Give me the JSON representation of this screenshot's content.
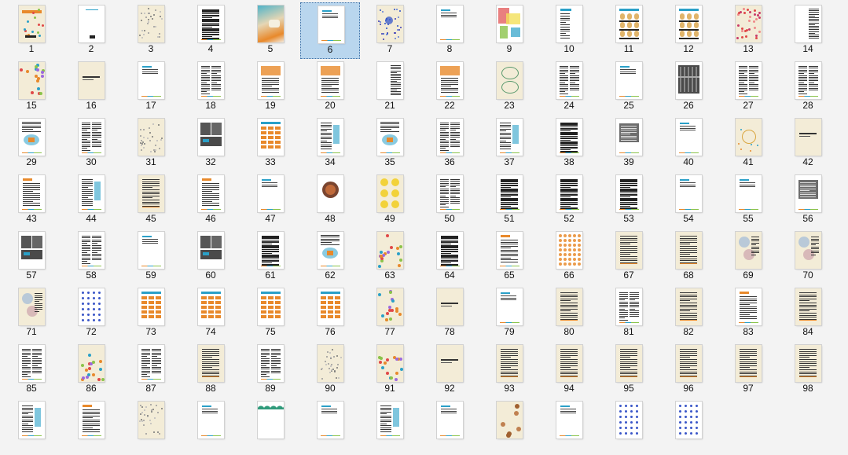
{
  "view": "thumbnail-grid",
  "selected_page": "6",
  "pages": [
    {
      "label": "1",
      "style": "cover-colorful"
    },
    {
      "label": "2",
      "style": "blank-small-logo"
    },
    {
      "label": "3",
      "style": "paper-sketch"
    },
    {
      "label": "4",
      "style": "text-dense"
    },
    {
      "label": "5",
      "style": "cover-watercolor"
    },
    {
      "label": "6",
      "style": "text-sparse"
    },
    {
      "label": "7",
      "style": "network-blue"
    },
    {
      "label": "8",
      "style": "text-sparse"
    },
    {
      "label": "9",
      "style": "color-blocks"
    },
    {
      "label": "10",
      "style": "text-list"
    },
    {
      "label": "11",
      "style": "figures"
    },
    {
      "label": "12",
      "style": "figures"
    },
    {
      "label": "13",
      "style": "paper-red-dots"
    },
    {
      "label": "14",
      "style": "text-column"
    },
    {
      "label": "15",
      "style": "paper-colorful-diagram"
    },
    {
      "label": "16",
      "style": "paper-title"
    },
    {
      "label": "17",
      "style": "text-sparse"
    },
    {
      "label": "18",
      "style": "text-two-col"
    },
    {
      "label": "19",
      "style": "text-orange-box"
    },
    {
      "label": "20",
      "style": "text-orange-box"
    },
    {
      "label": "21",
      "style": "text-column"
    },
    {
      "label": "22",
      "style": "text-orange-box"
    },
    {
      "label": "23",
      "style": "paper-green-sketch"
    },
    {
      "label": "24",
      "style": "text-two-col"
    },
    {
      "label": "25",
      "style": "text-sparse"
    },
    {
      "label": "26",
      "style": "dark-photo"
    },
    {
      "label": "27",
      "style": "text-two-col"
    },
    {
      "label": "28",
      "style": "text-two-col"
    },
    {
      "label": "29",
      "style": "text-with-diagram"
    },
    {
      "label": "30",
      "style": "text-two-col"
    },
    {
      "label": "31",
      "style": "paper-sketch"
    },
    {
      "label": "32",
      "style": "dark-panels"
    },
    {
      "label": "33",
      "style": "orange-table"
    },
    {
      "label": "34",
      "style": "text-blue-accent"
    },
    {
      "label": "35",
      "style": "text-with-diagram"
    },
    {
      "label": "36",
      "style": "text-two-col"
    },
    {
      "label": "37",
      "style": "text-blue-accent"
    },
    {
      "label": "38",
      "style": "text-dense"
    },
    {
      "label": "39",
      "style": "text-gray-box"
    },
    {
      "label": "40",
      "style": "text-sparse"
    },
    {
      "label": "41",
      "style": "paper-sketch-yellow"
    },
    {
      "label": "42",
      "style": "paper-title"
    },
    {
      "label": "43",
      "style": "text-orange-accent"
    },
    {
      "label": "44",
      "style": "text-blue-accent"
    },
    {
      "label": "45",
      "style": "paper-text"
    },
    {
      "label": "46",
      "style": "text-orange-accent"
    },
    {
      "label": "47",
      "style": "text-sparse"
    },
    {
      "label": "48",
      "style": "dark-circle"
    },
    {
      "label": "49",
      "style": "yellow-circles"
    },
    {
      "label": "50",
      "style": "text-two-col"
    },
    {
      "label": "51",
      "style": "text-dense"
    },
    {
      "label": "52",
      "style": "text-dense"
    },
    {
      "label": "53",
      "style": "text-dense"
    },
    {
      "label": "54",
      "style": "text-sparse"
    },
    {
      "label": "55",
      "style": "text-sparse"
    },
    {
      "label": "56",
      "style": "text-gray-box"
    },
    {
      "label": "57",
      "style": "dark-panels"
    },
    {
      "label": "58",
      "style": "text-two-col"
    },
    {
      "label": "59",
      "style": "text-sparse"
    },
    {
      "label": "60",
      "style": "dark-panels"
    },
    {
      "label": "61",
      "style": "text-dense"
    },
    {
      "label": "62",
      "style": "text-with-diagram"
    },
    {
      "label": "63",
      "style": "paper-colorful-diagram"
    },
    {
      "label": "64",
      "style": "text-dense"
    },
    {
      "label": "65",
      "style": "text-orange-accent"
    },
    {
      "label": "66",
      "style": "orange-dots"
    },
    {
      "label": "67",
      "style": "paper-text"
    },
    {
      "label": "68",
      "style": "paper-text"
    },
    {
      "label": "69",
      "style": "paper-circles"
    },
    {
      "label": "70",
      "style": "paper-circles"
    },
    {
      "label": "71",
      "style": "paper-circles"
    },
    {
      "label": "72",
      "style": "blue-dots"
    },
    {
      "label": "73",
      "style": "orange-table"
    },
    {
      "label": "74",
      "style": "orange-table"
    },
    {
      "label": "75",
      "style": "orange-table"
    },
    {
      "label": "76",
      "style": "orange-table"
    },
    {
      "label": "77",
      "style": "paper-colorful-diagram"
    },
    {
      "label": "78",
      "style": "paper-title"
    },
    {
      "label": "79",
      "style": "text-sparse"
    },
    {
      "label": "80",
      "style": "paper-text"
    },
    {
      "label": "81",
      "style": "text-two-col"
    },
    {
      "label": "82",
      "style": "paper-text"
    },
    {
      "label": "83",
      "style": "text-orange-accent"
    },
    {
      "label": "84",
      "style": "paper-text"
    },
    {
      "label": "85",
      "style": "text-two-col"
    },
    {
      "label": "86",
      "style": "paper-colorful-diagram"
    },
    {
      "label": "87",
      "style": "text-two-col"
    },
    {
      "label": "88",
      "style": "paper-text"
    },
    {
      "label": "89",
      "style": "text-two-col"
    },
    {
      "label": "90",
      "style": "paper-sketch"
    },
    {
      "label": "91",
      "style": "paper-colorful-diagram"
    },
    {
      "label": "92",
      "style": "paper-title"
    },
    {
      "label": "93",
      "style": "paper-text"
    },
    {
      "label": "94",
      "style": "paper-text"
    },
    {
      "label": "95",
      "style": "paper-text"
    },
    {
      "label": "96",
      "style": "paper-text"
    },
    {
      "label": "97",
      "style": "paper-text"
    },
    {
      "label": "98",
      "style": "paper-text"
    },
    {
      "label": "",
      "style": "text-blue-accent"
    },
    {
      "label": "",
      "style": "text-orange-accent"
    },
    {
      "label": "",
      "style": "paper-sketch"
    },
    {
      "label": "",
      "style": "text-sparse"
    },
    {
      "label": "",
      "style": "green-wave"
    },
    {
      "label": "",
      "style": "text-sparse"
    },
    {
      "label": "",
      "style": "text-blue-accent"
    },
    {
      "label": "",
      "style": "text-sparse"
    },
    {
      "label": "",
      "style": "paper-figures"
    },
    {
      "label": "",
      "style": "text-sparse"
    },
    {
      "label": "",
      "style": "blue-dots"
    },
    {
      "label": "",
      "style": "blue-dots"
    }
  ],
  "colors": {
    "background": "#f3f3f3",
    "selection_fill": "#b9d6ee",
    "selection_border": "#3a6ea5",
    "paper": "#f3ecd7",
    "accent_orange": "#e8892b",
    "accent_blue": "#2aa0c8"
  }
}
